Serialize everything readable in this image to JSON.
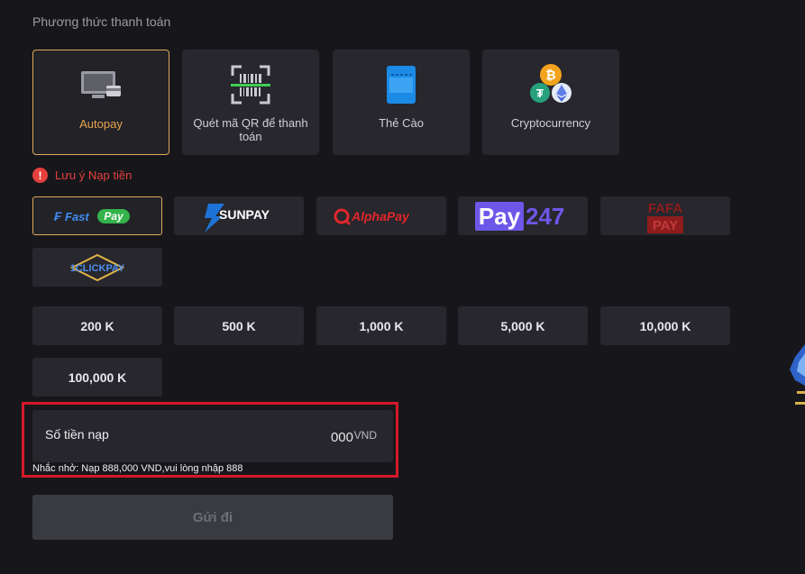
{
  "header": {
    "title": "Phương thức thanh toán"
  },
  "methods": [
    {
      "label": "Autopay",
      "icon": "monitor-card-icon",
      "active": true
    },
    {
      "label": "Quét mã QR để thanh toán",
      "icon": "qr-scan-icon",
      "active": false
    },
    {
      "label": "Thẻ Cào",
      "icon": "scratch-card-icon",
      "active": false
    },
    {
      "label": "Cryptocurrency",
      "icon": "crypto-coins-icon",
      "active": false
    }
  ],
  "notice": {
    "label": "Lưu ý Nạp tiền",
    "icon": "exclamation-icon"
  },
  "providers": [
    {
      "name": "FastPay",
      "logo_a": "Fast",
      "logo_b": "Pay",
      "active": true
    },
    {
      "name": "SUNPAY",
      "logo_a": "SUNPAY"
    },
    {
      "name": "AlphaPay",
      "logo_a": "AlphaPay"
    },
    {
      "name": "Pay247",
      "logo_a": "Pay",
      "logo_b": "247"
    },
    {
      "name": "FAFAPAY",
      "logo_a": "FAFA",
      "logo_b": "PAY"
    },
    {
      "name": "1CLICKPAY",
      "logo_a": "1CLICKPAY"
    }
  ],
  "amounts": [
    "200 K",
    "500 K",
    "1,000 K",
    "5,000 K",
    "10,000 K",
    "100,000 K"
  ],
  "deposit": {
    "label": "Số tiền nạp",
    "placeholder": "000",
    "unit": "VND",
    "hint": "Nhắc nhở: Nạp 888,000 VND,vui lòng nhập 888"
  },
  "submit": {
    "label": "Gửi đi"
  },
  "colors": {
    "accent": "#e0a85b",
    "warning": "#e5403d",
    "highlight": "#d3192a",
    "background": "#17171b",
    "card": "#27272d"
  }
}
